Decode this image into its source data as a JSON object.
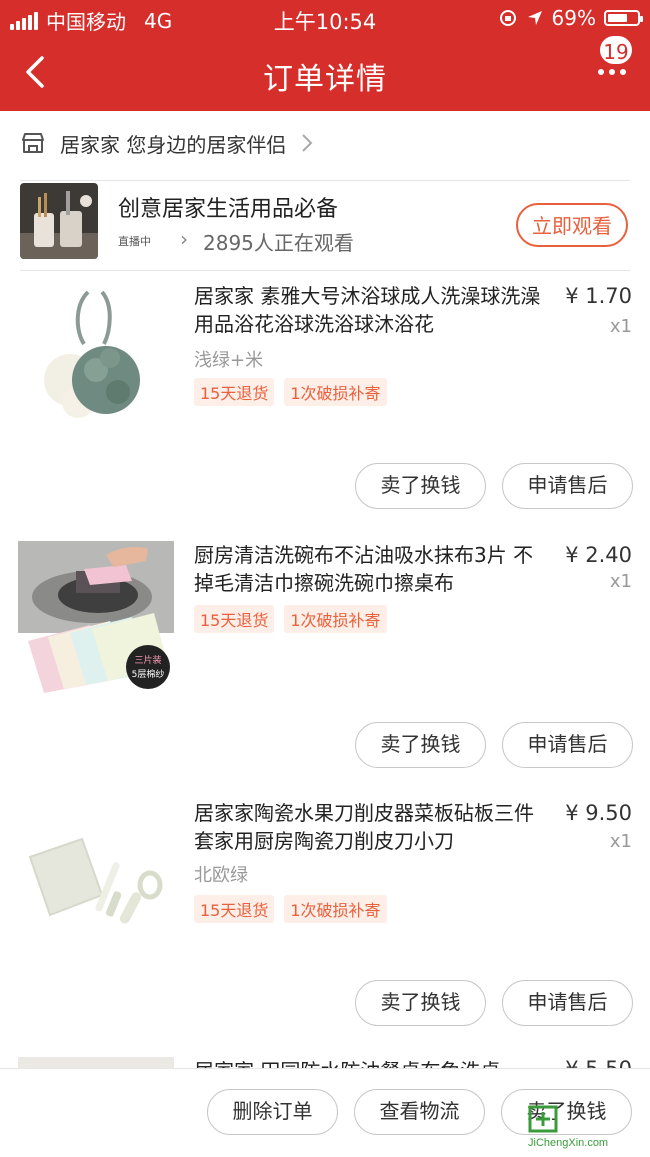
{
  "status_bar": {
    "carrier": "中国移动",
    "network": "4G",
    "time": "上午10:54",
    "battery": "69%",
    "battery_level": 0.69
  },
  "header": {
    "title": "订单详情",
    "badge": "19"
  },
  "shop": {
    "name": "居家家 您身边的居家伴侣"
  },
  "live": {
    "title": "创意居家生活用品必备",
    "tag": "直播中",
    "viewers": "2895人正在观看",
    "button": "立即观看"
  },
  "items": [
    {
      "name": "居家家 素雅大号沐浴球成人洗澡球洗澡用品浴花浴球洗浴球沐浴花",
      "price": "¥ 1.70",
      "qty": "x1",
      "sku": "浅绿+米",
      "tags": [
        "15天退货",
        "1次破损补寄"
      ],
      "btn_sell": "卖了换钱",
      "btn_after": "申请售后"
    },
    {
      "name": "厨房清洁洗碗布不沾油吸水抹布3片 不掉毛清洁巾擦碗洗碗巾擦桌布",
      "price": "¥ 2.40",
      "qty": "x1",
      "sku": "",
      "tags": [
        "15天退货",
        "1次破损补寄"
      ],
      "btn_sell": "卖了换钱",
      "btn_after": "申请售后",
      "badge_top": "三片装",
      "badge_bottom": "5层棉纱"
    },
    {
      "name": "居家家陶瓷水果刀削皮器菜板砧板三件套家用厨房陶瓷刀削皮刀小刀",
      "price": "¥ 9.50",
      "qty": "x1",
      "sku": "北欧绿",
      "tags": [
        "15天退货",
        "1次破损补寄"
      ],
      "btn_sell": "卖了换钱",
      "btn_after": "申请售后"
    },
    {
      "name": "居家家 田园防水防油餐桌布免洗桌",
      "price": "¥ 5.50"
    }
  ],
  "bottom_bar": {
    "delete": "删除订单",
    "logistics": "查看物流",
    "sell": "卖了换钱"
  },
  "watermark": {
    "text": "JiChengXin.com"
  },
  "colors": {
    "header_red": "#d62f2b",
    "accent_orange": "#e8603c"
  }
}
